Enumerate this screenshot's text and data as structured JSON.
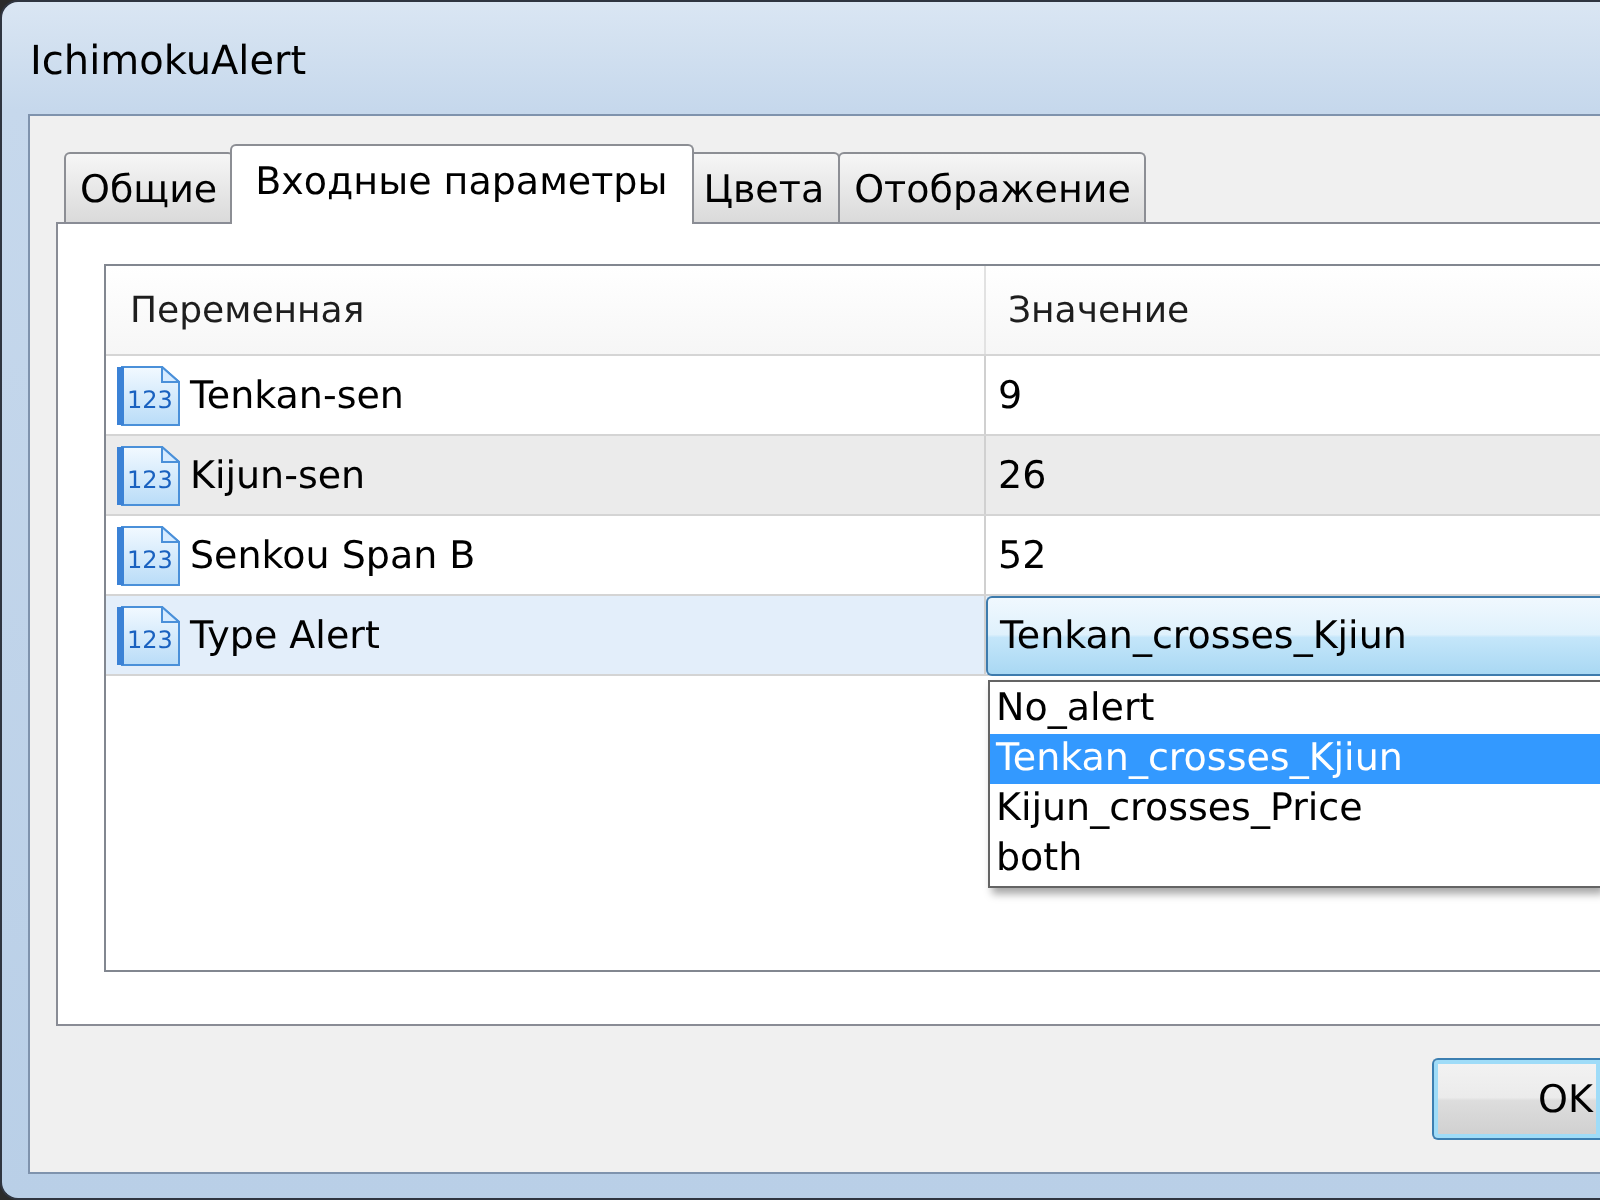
{
  "window": {
    "title": "IchimokuAlert"
  },
  "tabs": [
    {
      "label": "Общие",
      "selected": false
    },
    {
      "label": "Входные параметры",
      "selected": true
    },
    {
      "label": "Цвета",
      "selected": false
    },
    {
      "label": "Отображение",
      "selected": false
    }
  ],
  "table": {
    "columns": [
      "Переменная",
      "Значение"
    ],
    "rows": [
      {
        "kind": "number",
        "type_badge": "123",
        "name": "Tenkan-sen",
        "value": "9",
        "selected": false
      },
      {
        "kind": "number",
        "type_badge": "123",
        "name": "Kijun-sen",
        "value": "26",
        "selected": false
      },
      {
        "kind": "number",
        "type_badge": "123",
        "name": "Senkou Span B",
        "value": "52",
        "selected": false
      },
      {
        "kind": "enum",
        "type_badge": "123",
        "name": "Type Alert",
        "value": "Tenkan_crosses_Kjiun",
        "selected": true,
        "expanded": true,
        "options": [
          {
            "label": "No_alert",
            "selected": false
          },
          {
            "label": "Tenkan_crosses_Kjiun",
            "selected": true
          },
          {
            "label": "Kijun_crosses_Price",
            "selected": false
          },
          {
            "label": "both",
            "selected": false
          }
        ]
      }
    ]
  },
  "buttons": [
    {
      "label": "OK",
      "focused": true
    }
  ]
}
